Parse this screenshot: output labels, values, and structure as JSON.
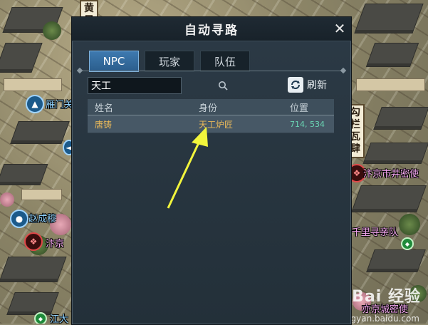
{
  "dialog": {
    "title": "自动寻路",
    "close_icon": "close-icon",
    "tabs": [
      {
        "label": "NPC",
        "active": true
      },
      {
        "label": "玩家",
        "active": false
      },
      {
        "label": "队伍",
        "active": false
      }
    ],
    "search": {
      "value": "天工",
      "icon": "search-icon"
    },
    "refresh": {
      "label": "刷新",
      "icon": "refresh-icon"
    },
    "table": {
      "headers": {
        "name": "姓名",
        "role": "身份",
        "position": "位置"
      },
      "rows": [
        {
          "name": "唐铸",
          "role": "天工炉匠",
          "position": "714, 534"
        }
      ]
    }
  },
  "map": {
    "signs": {
      "top": "黄风",
      "right": "勾栏瓦肆"
    },
    "labels": {
      "gate": "雁门关",
      "person": "赵成穆",
      "right_top": "汴京市井密使",
      "right_mid": "千里寻亲队",
      "bottom_left": "江大",
      "bottom_right": "亦京城密使",
      "left_mid": "汴京"
    }
  },
  "watermark": {
    "main": "Bai 经验",
    "sub": "jingyan.baidu.com"
  },
  "colors": {
    "tab_active": "#2b5d8c",
    "npc_text": "#e8b85a",
    "position_text": "#6ad6b4",
    "arrow": "#f2f53c"
  }
}
